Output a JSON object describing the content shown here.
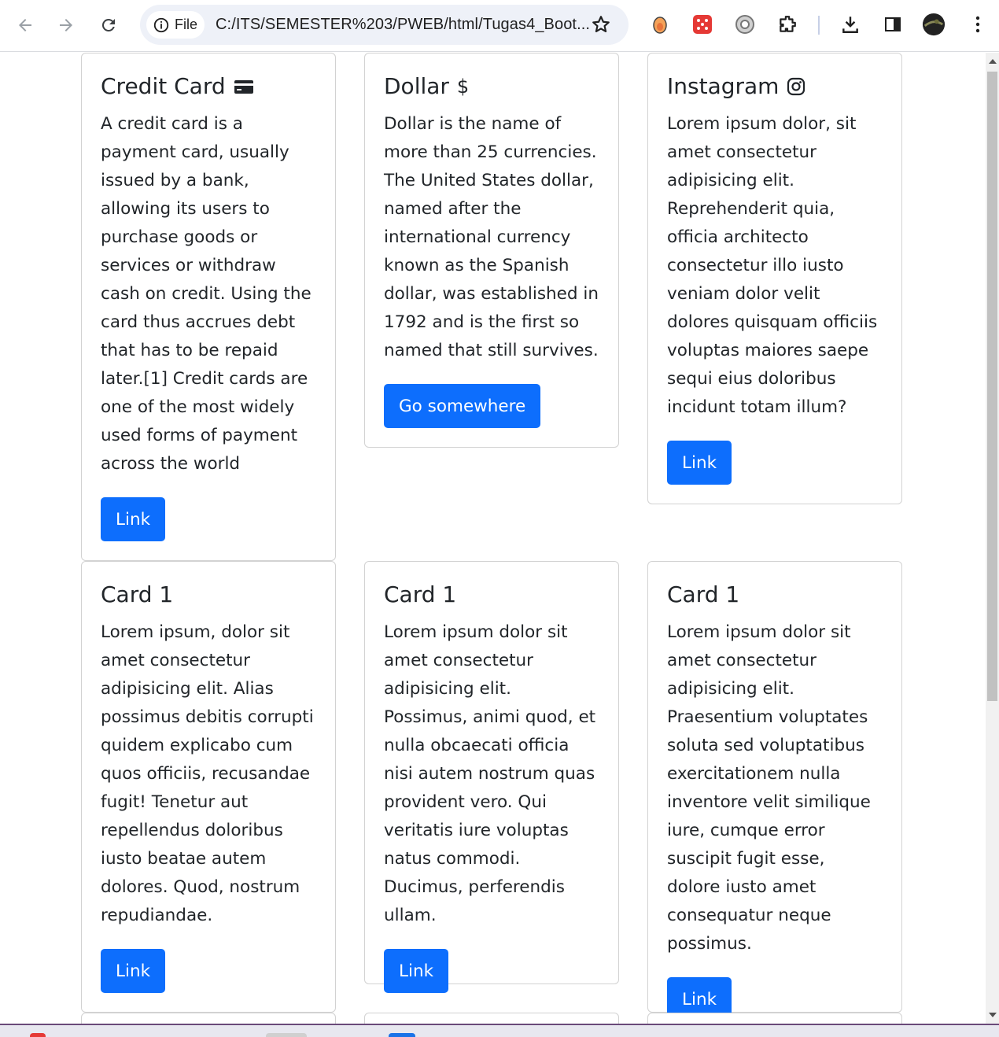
{
  "browser": {
    "file_label": "File",
    "url": "C:/ITS/SEMESTER%203/PWEB/html/Tugas4_Boot...",
    "icons": [
      "back-icon",
      "forward-icon",
      "reload-icon",
      "info-icon",
      "star-icon",
      "extension-icon",
      "download-icon",
      "side-panel-icon",
      "profile-avatar",
      "menu-icon"
    ]
  },
  "colors": {
    "primary": "#0d6efd",
    "text": "#212529",
    "border": "#dee2e6"
  },
  "cards": [
    {
      "title": "Credit Card",
      "icon": "credit-card-icon",
      "text": "A credit card is a payment card, usually issued by a bank, allowing its users to purchase goods or services or withdraw cash on credit. Using the card thus accrues debt that has to be repaid later.[1] Credit cards are one of the most widely used forms of payment across the world",
      "button": "Link"
    },
    {
      "title": "Dollar",
      "icon": "dollar-icon",
      "text": "Dollar is the name of more than 25 currencies. The United States dollar, named after the international currency known as the Spanish dollar, was established in 1792 and is the first so named that still survives.",
      "button": "Go somewhere"
    },
    {
      "title": "Instagram",
      "icon": "instagram-icon",
      "text": "Lorem ipsum dolor, sit amet consectetur adipisicing elit. Reprehenderit quia, officia architecto consectetur illo iusto veniam dolor velit dolores quisquam officiis voluptas maiores saepe sequi eius doloribus incidunt totam illum?",
      "button": "Link"
    },
    {
      "title": "Card 1",
      "text": "Lorem ipsum, dolor sit amet consectetur adipisicing elit. Alias possimus debitis corrupti quidem explicabo cum quos officiis, recusandae fugit! Tenetur aut repellendus doloribus iusto beatae autem dolores. Quod, nostrum repudiandae.",
      "button": "Link"
    },
    {
      "title": "Card 1",
      "text": "Lorem ipsum dolor sit amet consectetur adipisicing elit. Possimus, animi quod, et nulla obcaecati officia nisi autem nostrum quas provident vero. Qui veritatis iure voluptas natus commodi. Ducimus, perferendis ullam.",
      "button": "Link"
    },
    {
      "title": "Card 1",
      "text": "Lorem ipsum dolor sit amet consectetur adipisicing elit. Praesentium voluptates soluta sed voluptatibus exercitationem nulla inventore velit similique iure, cumque error suscipit fugit esse, dolore iusto amet consequatur neque possimus.",
      "button": "Link"
    }
  ]
}
